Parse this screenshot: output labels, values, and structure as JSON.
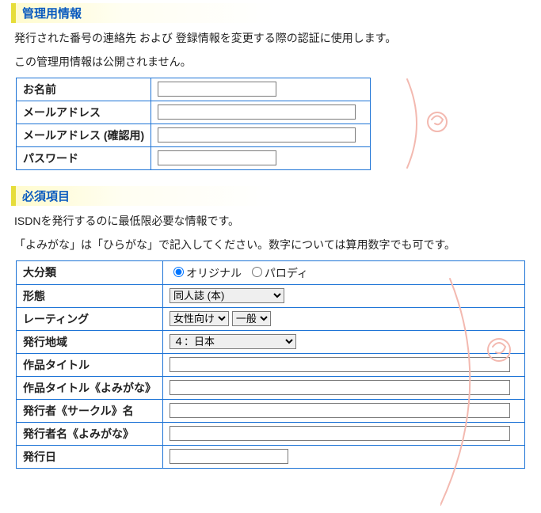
{
  "section1": {
    "heading": "管理用情報",
    "intro1": "発行された番号の連絡先 および 登録情報を変更する際の認証に使用します。",
    "intro2": "この管理用情報は公開されません。",
    "rows": {
      "name": {
        "label": "お名前"
      },
      "mail": {
        "label": "メールアドレス"
      },
      "mail2": {
        "label": "メールアドレス (確認用)"
      },
      "pass": {
        "label": "パスワード"
      }
    }
  },
  "section2": {
    "heading": "必須項目",
    "intro1": "ISDNを発行するのに最低限必要な情報です。",
    "intro2": "「よみがな」は「ひらがな」で記入してください。数字については算用数字でも可です。",
    "rows": {
      "category": {
        "label": "大分類",
        "opt_original": "オリジナル",
        "opt_parody": "パロディ"
      },
      "form": {
        "label": "形態",
        "selected": "同人誌 (本)"
      },
      "rating": {
        "label": "レーティング",
        "sel1": "女性向け",
        "sel2": "一般"
      },
      "region": {
        "label": "発行地域",
        "selected": "４：日本"
      },
      "title": {
        "label": "作品タイトル"
      },
      "title_yomi": {
        "label": "作品タイトル《よみがな》"
      },
      "publisher": {
        "label": "発行者《サークル》名"
      },
      "publisher_yomi": {
        "label": "発行者名《よみがな》"
      },
      "date": {
        "label": "発行日"
      }
    }
  }
}
